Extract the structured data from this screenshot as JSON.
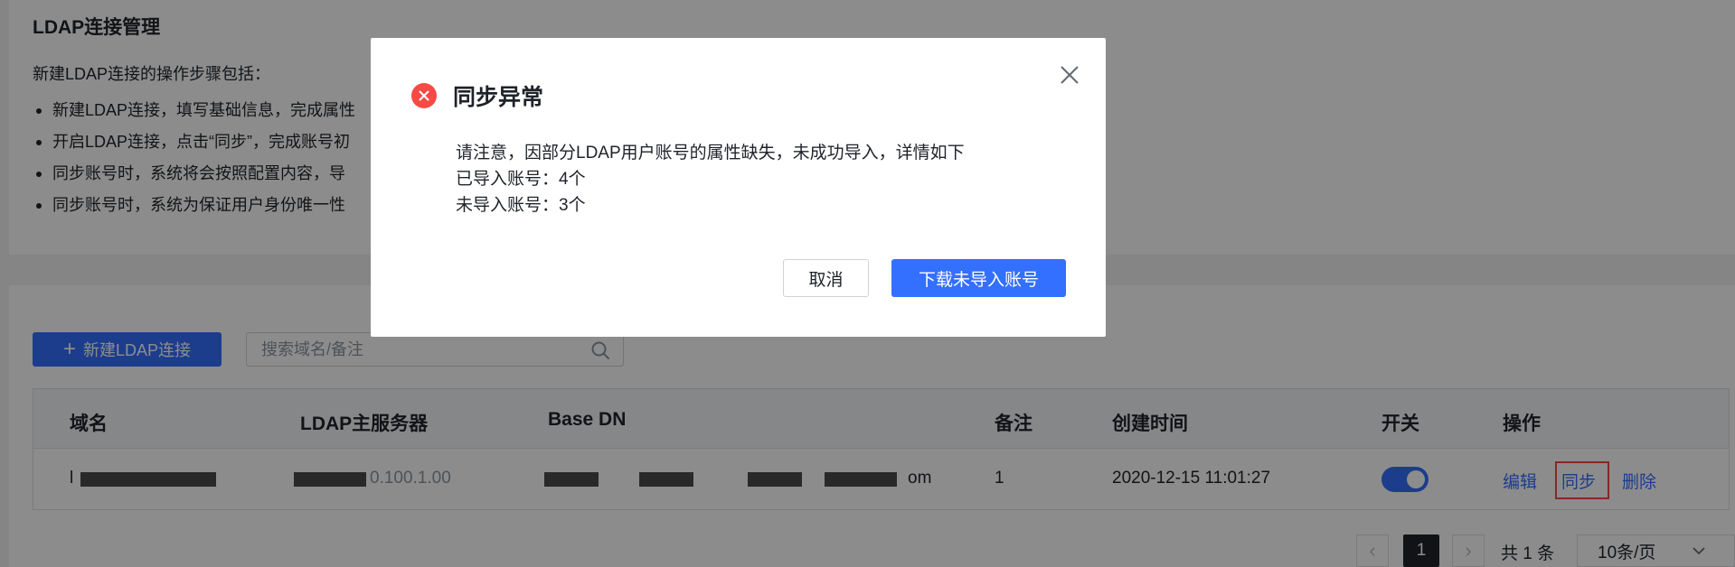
{
  "page": {
    "title": "LDAP连接管理",
    "steps_intro": "新建LDAP连接的操作步骤包括：",
    "steps": [
      "新建LDAP连接，填写基础信息，完成属性",
      "开启LDAP连接，点击“同步”，完成账号初",
      "同步账号时，系统将会按照配置内容，导",
      "同步账号时，系统为保证用户身份唯一性"
    ]
  },
  "toolbar": {
    "new_button": "新建LDAP连接",
    "search_placeholder": "搜索域名/备注"
  },
  "table": {
    "headers": [
      "域名",
      "LDAP主服务器",
      "Base DN",
      "备注",
      "创建时间",
      "开关",
      "操作"
    ],
    "rows": [
      {
        "domain_visible": "l",
        "server_visible": "0.100.1.00",
        "base_dn_visible": "om",
        "remark": "1",
        "created_at": "2020-12-15 11:01:27",
        "enabled": true,
        "actions": [
          "编辑",
          "同步",
          "删除"
        ]
      }
    ]
  },
  "pagination": {
    "current_page": "1",
    "total": "共 1 条",
    "page_size": "10条/页"
  },
  "dialog": {
    "title": "同步异常",
    "message": "请注意，因部分LDAP用户账号的属性缺失，未成功导入，详情如下",
    "imported": "已导入账号：4个",
    "not_imported": "未导入账号：3个",
    "cancel_label": "取消",
    "download_label": "下载未导入账号"
  },
  "colors": {
    "primary": "#3370ff",
    "error": "#f54a45",
    "highlight_border": "#f54a45"
  }
}
